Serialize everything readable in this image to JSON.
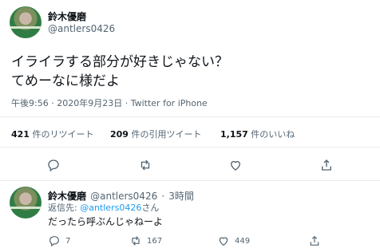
{
  "tweet": {
    "author_name": "鈴木優磨",
    "author_handle": "@antlers0426",
    "text_line1": "イライラする部分が好きじゃない？",
    "text_line2": "てめーなに様だよ",
    "time": "午後9:56",
    "date": "2020年9月23日",
    "sep": "·",
    "source": "Twitter for iPhone",
    "retweets_count": "421",
    "retweets_label": "件のリツイート",
    "quotes_count": "209",
    "quotes_label": "件の引用ツイート",
    "likes_count": "1,157",
    "likes_label": "件のいいね"
  },
  "reply": {
    "author_name": "鈴木優磨",
    "author_handle": "@antlers0426",
    "sep": "·",
    "age": "3時間",
    "reply_to_label": "返信先:",
    "reply_to_handle": "@antlers0426",
    "reply_to_suffix": "さん",
    "text": "だったら呼ぶんじゃねーよ",
    "reply_count": "7",
    "retweet_count": "167",
    "like_count": "449"
  },
  "icons": {
    "reply": "reply-icon",
    "retweet": "retweet-icon",
    "like": "heart-icon",
    "share": "share-icon"
  },
  "colors": {
    "link": "#1d9bf0",
    "muted": "#536471",
    "text": "#0f1419",
    "divider": "#e6ecf0"
  }
}
